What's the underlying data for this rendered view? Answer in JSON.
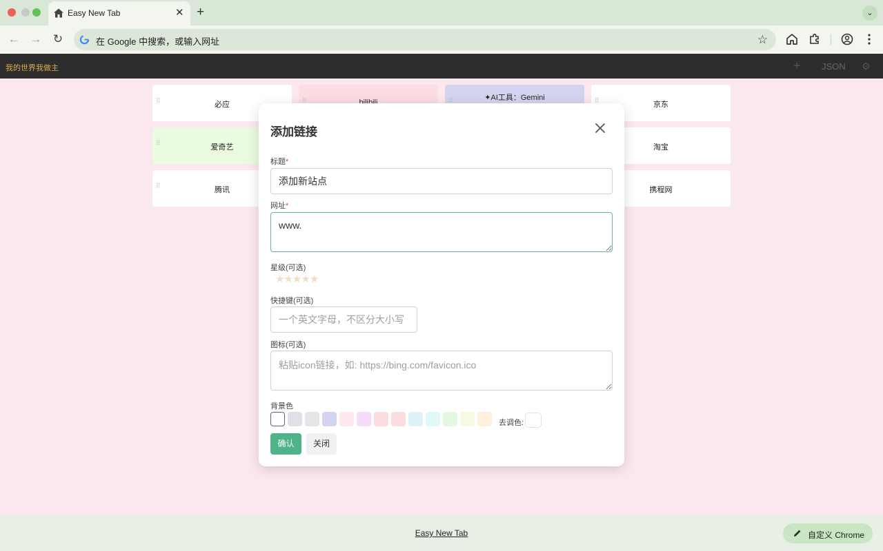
{
  "browser": {
    "tab_title": "Easy New Tab",
    "tab_close": "✕",
    "new_tab": "+",
    "tab_menu": "⌄",
    "omnibox_placeholder": "在 Google 中搜索，或输入网址"
  },
  "app": {
    "title": "我的世界我做主",
    "add_label": "+",
    "json_label": "JSON",
    "settings_label": "⚙"
  },
  "links": [
    {
      "title": "必应",
      "color": "#ffffff"
    },
    {
      "title": "bilibili",
      "color": "#fbdde2"
    },
    {
      "title": "✦AI工具：Gemini",
      "color": "#d4d4f0"
    },
    {
      "title": "京东",
      "color": "#ffffff"
    },
    {
      "title": "爱奇艺",
      "color": "#ebfbe0"
    },
    {
      "title": "淘宝",
      "color": "#ffffff"
    },
    {
      "title": "腾讯",
      "color": "#ffffff"
    },
    {
      "title": "携程网",
      "color": "#ffffff"
    }
  ],
  "modal": {
    "title": "添加链接",
    "title_label": "标题",
    "required_mark": "*",
    "title_value": "添加新站点",
    "url_label": "网址",
    "url_value": "www.",
    "stars_label": "星级(可选)",
    "stars_value": 0,
    "stars_max": 5,
    "shortcut_label": "快捷键(可选)",
    "shortcut_placeholder": "一个英文字母，不区分大小写",
    "icon_label": "图标(可选)",
    "icon_placeholder": "粘贴icon链接，如: https://bing.com/favicon.ico",
    "bg_label": "背景色",
    "colors": [
      "#ffffff",
      "#dfe0ea",
      "#e5e5e8",
      "#d4d4f0",
      "#fce8ee",
      "#f6dcf8",
      "#fadce1",
      "#fbdde0",
      "#dff2fb",
      "#dff9f6",
      "#e3f8e1",
      "#f5fbe3",
      "#fdf0dc"
    ],
    "selected_color": "#ffffff",
    "decolor_label": "去调色:",
    "confirm_label": "确认",
    "close_label": "关闭"
  },
  "footer": {
    "link_text": "Easy New Tab",
    "customize_label": "自定义 Chrome"
  }
}
